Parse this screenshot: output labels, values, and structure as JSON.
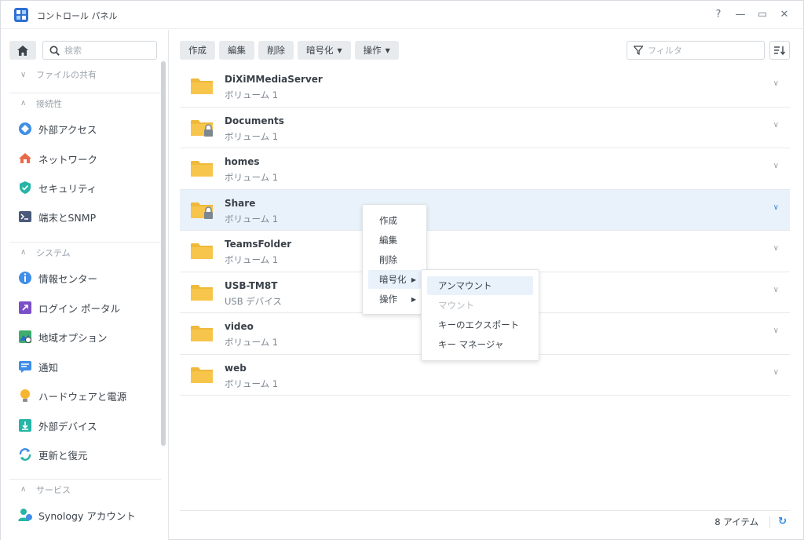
{
  "window": {
    "title": "コントロール パネル",
    "help": "?",
    "minimize": "—",
    "maximize": "▭",
    "close": "✕"
  },
  "sidebar": {
    "search_placeholder": "検索",
    "sections": [
      {
        "label": "ファイルの共有",
        "expanded": false
      },
      {
        "label": "接続性",
        "expanded": true
      },
      {
        "label": "システム",
        "expanded": true
      },
      {
        "label": "サービス",
        "expanded": true
      }
    ],
    "items": [
      {
        "label": "外部アクセス",
        "icon": "external-access-icon"
      },
      {
        "label": "ネットワーク",
        "icon": "network-icon"
      },
      {
        "label": "セキュリティ",
        "icon": "security-shield-icon"
      },
      {
        "label": "端末とSNMP",
        "icon": "terminal-icon"
      },
      {
        "label": "情報センター",
        "icon": "info-icon"
      },
      {
        "label": "ログイン ポータル",
        "icon": "login-portal-icon"
      },
      {
        "label": "地域オプション",
        "icon": "regional-options-icon"
      },
      {
        "label": "通知",
        "icon": "notification-icon"
      },
      {
        "label": "ハードウェアと電源",
        "icon": "hardware-power-icon"
      },
      {
        "label": "外部デバイス",
        "icon": "external-device-icon"
      },
      {
        "label": "更新と復元",
        "icon": "update-restore-icon"
      },
      {
        "label": "Synology アカウント",
        "icon": "synology-account-icon"
      }
    ]
  },
  "toolbar": {
    "create": "作成",
    "edit": "編集",
    "delete": "削除",
    "encrypt": "暗号化",
    "action": "操作",
    "filter_placeholder": "フィルタ"
  },
  "folders": [
    {
      "name": "DiXiMMediaServer",
      "sub": "ボリューム 1",
      "locked": false,
      "selected": false
    },
    {
      "name": "Documents",
      "sub": "ボリューム 1",
      "locked": true,
      "selected": false
    },
    {
      "name": "homes",
      "sub": "ボリューム 1",
      "locked": false,
      "selected": false
    },
    {
      "name": "Share",
      "sub": "ボリューム 1",
      "locked": true,
      "selected": true
    },
    {
      "name": "TeamsFolder",
      "sub": "ボリューム 1",
      "locked": false,
      "selected": false
    },
    {
      "name": "USB-TM8T",
      "sub": "USB デバイス",
      "locked": false,
      "selected": false
    },
    {
      "name": "video",
      "sub": "ボリューム 1",
      "locked": false,
      "selected": false
    },
    {
      "name": "web",
      "sub": "ボリューム 1",
      "locked": false,
      "selected": false
    }
  ],
  "context_menu": {
    "items": [
      "作成",
      "編集",
      "削除",
      "暗号化",
      "操作"
    ]
  },
  "submenu": {
    "items": [
      "アンマウント",
      "マウント",
      "キーのエクスポート",
      "キー マネージャ"
    ],
    "disabled": [
      "マウント"
    ]
  },
  "status": {
    "count": "8 アイテム"
  },
  "colors": {
    "accent": "#2d8ae5",
    "folder": "#f7c54b",
    "selected_row": "#e9f1fb"
  }
}
